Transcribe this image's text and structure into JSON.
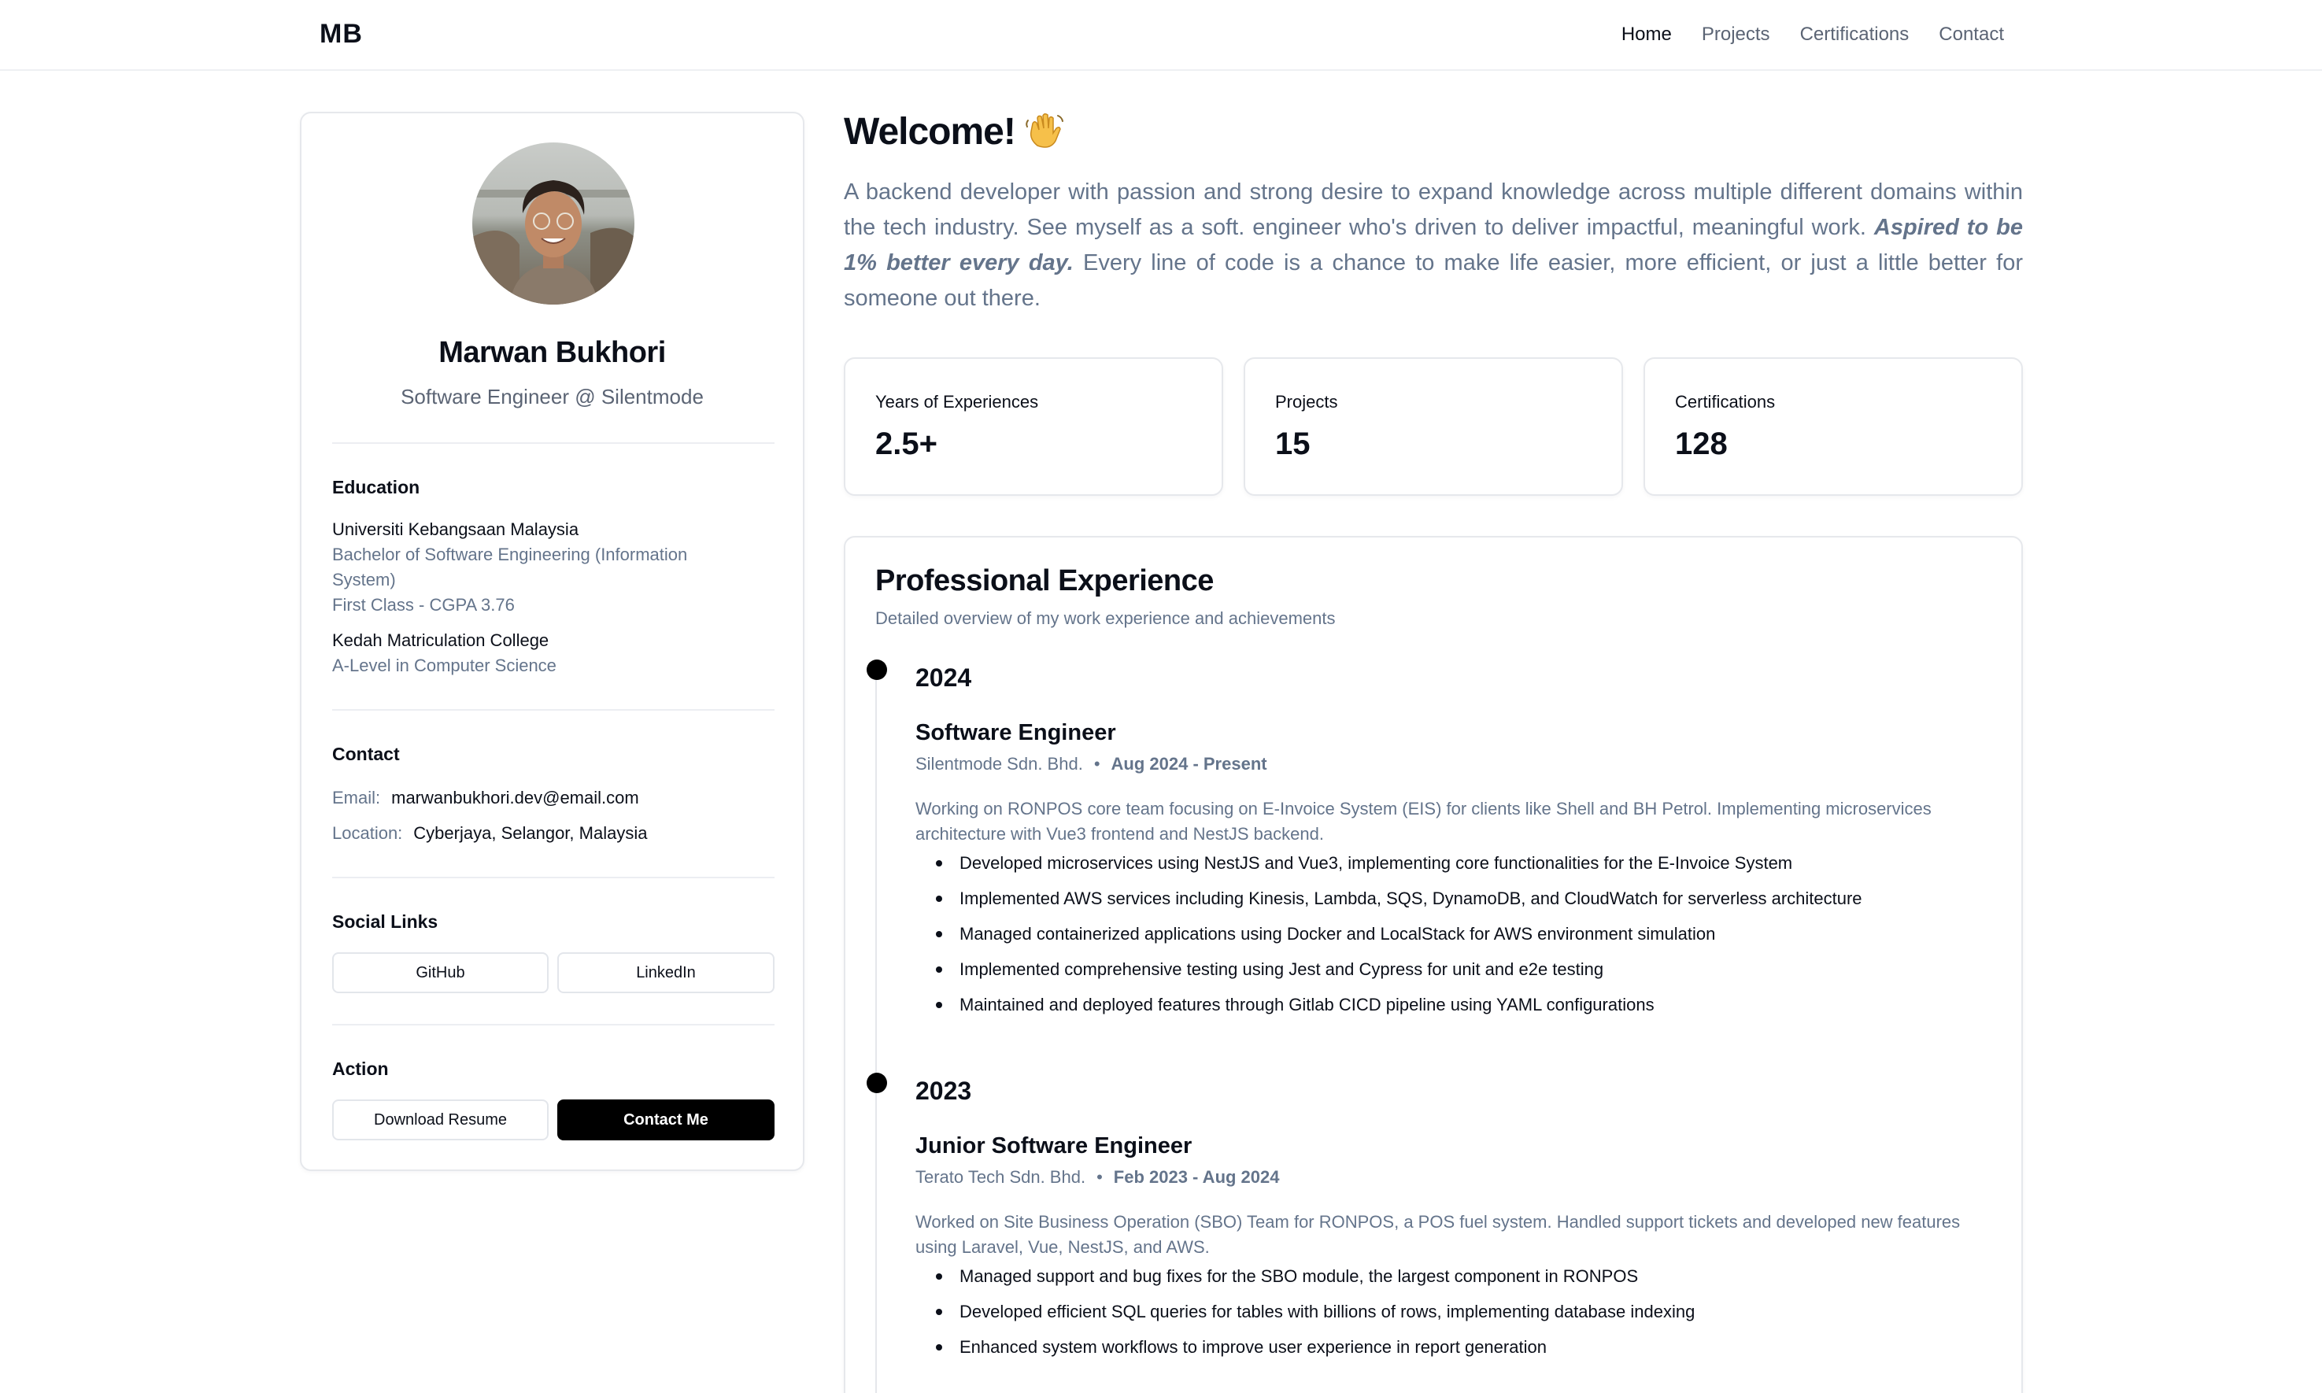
{
  "nav": {
    "logo": "MB",
    "links": [
      "Home",
      "Projects",
      "Certifications",
      "Contact"
    ],
    "active": "Home"
  },
  "profile": {
    "name": "Marwan Bukhori",
    "role": "Software Engineer @ Silentmode",
    "education": {
      "title": "Education",
      "items": [
        {
          "institution": "Universiti Kebangsaan Malaysia",
          "program_line1": "Bachelor of Software Engineering (Information",
          "program_line2": "System)",
          "grade": "First Class - CGPA 3.76"
        },
        {
          "institution": "Kedah Matriculation College",
          "program_line1": "A-Level in Computer Science"
        }
      ]
    },
    "contact": {
      "title": "Contact",
      "email_label": "Email:",
      "email": "marwanbukhori.dev@email.com",
      "location_label": "Location:",
      "location": "Cyberjaya, Selangor, Malaysia"
    },
    "social": {
      "title": "Social Links",
      "github": "GitHub",
      "linkedin": "LinkedIn"
    },
    "action": {
      "title": "Action",
      "download": "Download Resume",
      "contact": "Contact Me"
    }
  },
  "main": {
    "welcome": "Welcome!",
    "intro_part1": "A backend developer with passion and strong desire to expand knowledge across multiple different domains within the tech industry. See myself as a soft. engineer who's driven to deliver impactful, meaningful work. ",
    "intro_emphasis": "Aspired to be 1% better every day.",
    "intro_part2": " Every line of code is a chance to make life easier, more efficient, or just a little better for someone out there.",
    "stats": [
      {
        "label": "Years of Experiences",
        "value": "2.5+"
      },
      {
        "label": "Projects",
        "value": "15"
      },
      {
        "label": "Certifications",
        "value": "128"
      }
    ],
    "experience": {
      "title": "Professional Experience",
      "subtitle": "Detailed overview of my work experience and achievements",
      "entries": [
        {
          "year": "2024",
          "role": "Software Engineer",
          "company": "Silentmode Sdn. Bhd.",
          "separator": "•",
          "period": "Aug 2024 - Present",
          "description": "Working on RONPOS core team focusing on E-Invoice System (EIS) for clients like Shell and BH Petrol. Implementing microservices architecture with Vue3 frontend and NestJS backend.",
          "bullets": [
            "Developed microservices using NestJS and Vue3, implementing core functionalities for the E-Invoice System",
            "Implemented AWS services including Kinesis, Lambda, SQS, DynamoDB, and CloudWatch for serverless architecture",
            "Managed containerized applications using Docker and LocalStack for AWS environment simulation",
            "Implemented comprehensive testing using Jest and Cypress for unit and e2e testing",
            "Maintained and deployed features through Gitlab CICD pipeline using YAML configurations"
          ]
        },
        {
          "year": "2023",
          "role": "Junior Software Engineer",
          "company": "Terato Tech Sdn. Bhd.",
          "separator": "•",
          "period": "Feb 2023 - Aug 2024",
          "description": "Worked on Site Business Operation (SBO) Team for RONPOS, a POS fuel system. Handled support tickets and developed new features using Laravel, Vue, NestJS, and AWS.",
          "bullets": [
            "Managed support and bug fixes for the SBO module, the largest component in RONPOS",
            "Developed efficient SQL queries for tables with billions of rows, implementing database indexing",
            "Enhanced system workflows to improve user experience in report generation"
          ]
        }
      ]
    }
  }
}
